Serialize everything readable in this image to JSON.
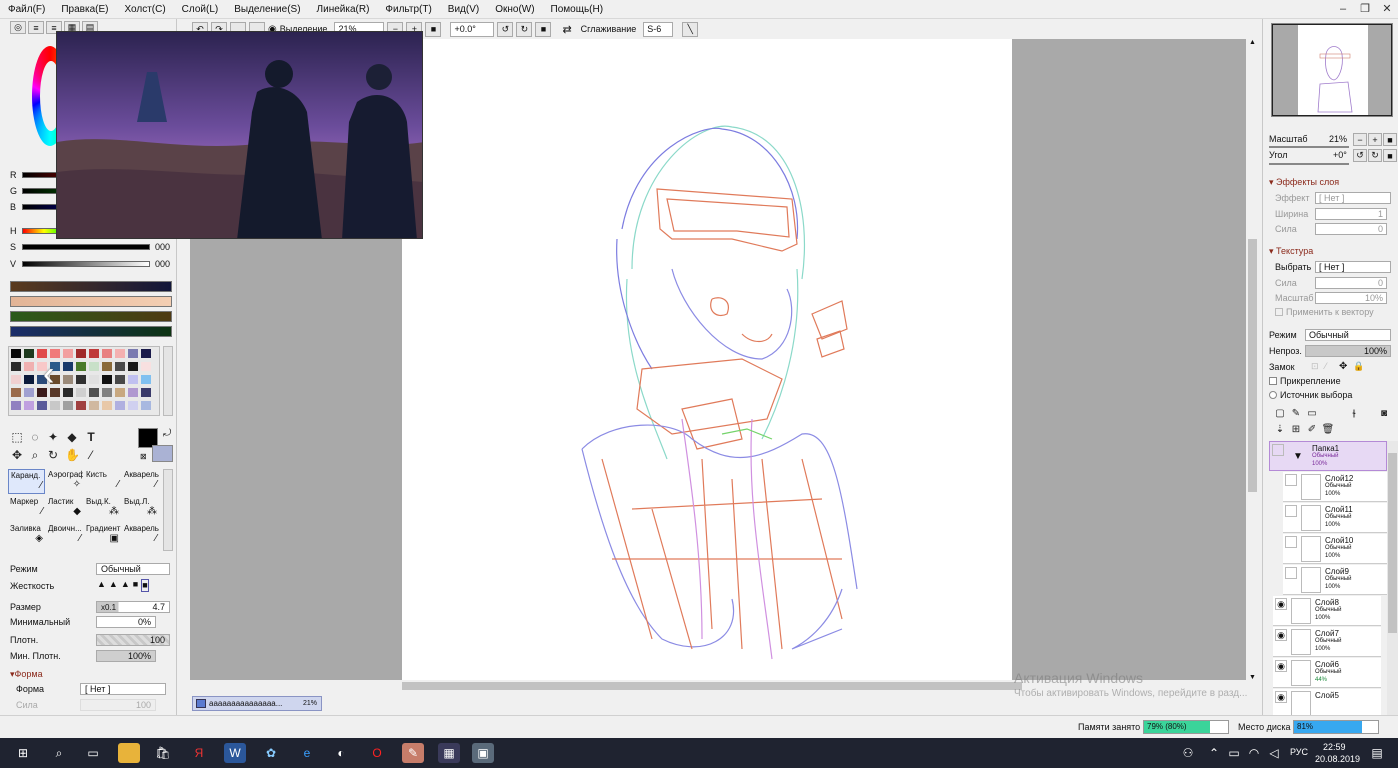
{
  "menubar": {
    "items": [
      "Файл(F)",
      "Правка(E)",
      "Холст(C)",
      "Слой(L)",
      "Выделение(S)",
      "Линейка(R)",
      "Фильтр(T)",
      "Вид(V)",
      "Окно(W)",
      "Помощь(H)"
    ]
  },
  "toolbar": {
    "selection_label": "Выделение",
    "zoom": "21%",
    "angle": "+0.0°",
    "smoothing_label": "Сглаживание",
    "smoothing_value": "S-6"
  },
  "color_panel": {
    "labels": {
      "r": "R",
      "g": "G",
      "b": "B",
      "h": "H",
      "s": "S",
      "v": "V"
    },
    "values": {
      "s": "000",
      "v": "000"
    },
    "swatch_colors": [
      "#5a3b1e",
      "#e8b999",
      "#2a5a1a",
      "#1b2d6a"
    ]
  },
  "tools": {
    "brushes": [
      {
        "name": "Каранд.",
        "selected": true
      },
      {
        "name": "Аэрограф"
      },
      {
        "name": "Кисть"
      },
      {
        "name": "Акварель"
      },
      {
        "name": "Маркер"
      },
      {
        "name": "Ластик"
      },
      {
        "name": "Выд.К."
      },
      {
        "name": "Выд.Л."
      },
      {
        "name": "Заливка"
      },
      {
        "name": "Двоичн..."
      },
      {
        "name": "Градиент"
      },
      {
        "name": "Акварель"
      }
    ]
  },
  "brush_props": {
    "mode_label": "Режим",
    "mode_value": "Обычный",
    "hardness_label": "Жесткость",
    "size_label": "Размер",
    "size_mult": "x0.1",
    "size_value": "4.7",
    "min_label": "Минимальный",
    "min_value": "0%",
    "density_label": "Плотн.",
    "density_value": "100",
    "min_density_label": "Мин. Плотн.",
    "min_density_value": "100%",
    "shape_section": "Форма",
    "shape_label": "Форма",
    "shape_value": "[ Нет ]",
    "strength_label": "Сила",
    "strength_value": "100"
  },
  "document_tab": {
    "name": "ааааааааааааааа...",
    "zoom": "21%"
  },
  "navigator": {
    "scale_label": "Масштаб",
    "scale_value": "21%",
    "angle_label": "Угол",
    "angle_value": "+0°"
  },
  "layer_effects": {
    "title": "Эффекты слоя",
    "effect_label": "Эффект",
    "effect_value": "[ Нет ]",
    "width_label": "Ширина",
    "width_value": "1",
    "strength_label": "Сила",
    "strength_value": "0"
  },
  "texture": {
    "title": "Текстура",
    "select_label": "Выбрать",
    "select_value": "[ Нет ]",
    "strength_label": "Сила",
    "strength_value": "0",
    "scale_label": "Масштаб",
    "scale_value": "10%",
    "apply_vector": "Применить к вектору"
  },
  "layer_props": {
    "mode_label": "Режим",
    "mode_value": "Обычный",
    "opacity_label": "Непроз.",
    "opacity_value": "100%",
    "lock_label": "Замок",
    "clip_label": "Прикрепление",
    "source_label": "Источник выбора"
  },
  "layers": [
    {
      "name": "Папка1",
      "mode": "Обычный",
      "opacity": "100%",
      "folder": true
    },
    {
      "name": "Слой12",
      "mode": "Обычный",
      "opacity": "100%"
    },
    {
      "name": "Слой11",
      "mode": "Обычный",
      "opacity": "100%"
    },
    {
      "name": "Слой10",
      "mode": "Обычный",
      "opacity": "100%"
    },
    {
      "name": "Слой9",
      "mode": "Обычный",
      "opacity": "100%"
    },
    {
      "name": "Слой8",
      "mode": "Обычный",
      "opacity": "100%"
    },
    {
      "name": "Слой7",
      "mode": "Обычный",
      "opacity": "100%"
    },
    {
      "name": "Слой6",
      "mode": "Обычный",
      "opacity": "44%"
    },
    {
      "name": "Слой5",
      "mode": "",
      "opacity": ""
    }
  ],
  "watermark": {
    "line1": "Активация Windows",
    "line2": "Чтобы активировать Windows, перейдите в разд..."
  },
  "status": {
    "memory_label": "Памяти занято",
    "memory_value": "79% (80%)",
    "memory_fraction": 0.79,
    "disk_label": "Место диска",
    "disk_value": "81%",
    "disk_fraction": 0.81
  },
  "taskbar": {
    "lang": "РУС",
    "time": "22:59",
    "date": "20.08.2019"
  }
}
